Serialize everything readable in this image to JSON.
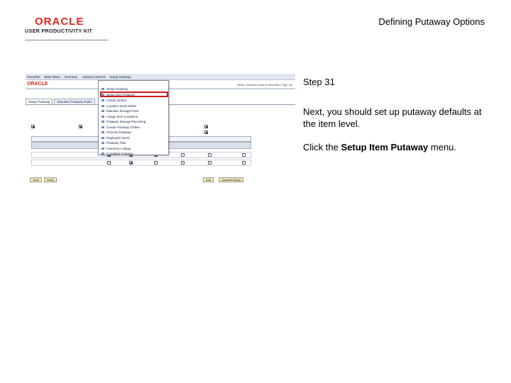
{
  "header": {
    "logo_main": "ORACLE",
    "logo_sub": "USER PRODUCTIVITY KIT",
    "page_title": "Defining Putaway Options"
  },
  "step": {
    "label": "Step 31"
  },
  "instructions": {
    "text": "Next, you should set up putaway defaults at the item level.",
    "action_prefix": "Click the ",
    "action_target": "Setup Item Putaway",
    "action_suffix": " menu."
  },
  "screenshot": {
    "menubar": [
      "Favorites",
      "Main Menu",
      "Inventory",
      "Advance Search",
      "Setup Putaway"
    ],
    "brand": "ORACLE",
    "brand_links": "Home | Worklist | Add to Favorites | Sign out",
    "tabs": [
      "Setup Putaway",
      "Standard Putaway Rules"
    ],
    "menu_items": [
      "Setup Putaway",
      "Setup Item Putaway",
      "Create Orders",
      "Location Stock Rules",
      "Maintain Storage Pack",
      "Assign Item Locations",
      "Putaway Storage Receiving",
      "Create Putaway Orders",
      "Process Putaway",
      "Replenish Stock",
      "Putaway Plan",
      "Inventory Lookup",
      "Complete Putaway"
    ],
    "buttons": [
      "Save",
      "Notify",
      "Add",
      "Update/Display"
    ]
  }
}
